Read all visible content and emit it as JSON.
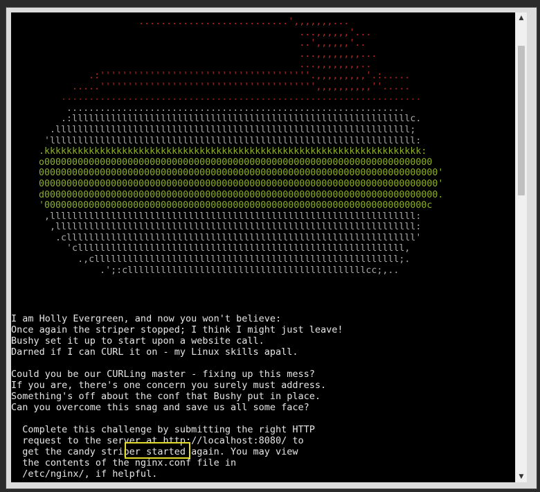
{
  "art_lines": [
    {
      "text": "                       ...........................',,,,,,,...",
      "tone": "c-red"
    },
    {
      "text": "                                                    ...,,,,,,'...",
      "tone": "c-red"
    },
    {
      "text": "                                                    ..',,,,,,'..",
      "tone": "c-red"
    },
    {
      "text": "                                                    ...,,,,,,,,...",
      "tone": "c-red"
    },
    {
      "text": "                                                    ...,,,,,,,,..",
      "tone": "c-red"
    },
    {
      "text": "              .:''''''''''''''''''''''''''''''''''''''.,,,,,,,,,'.:.....",
      "tone": "c-red"
    },
    {
      "text": "           .....''''''''''''''''''''''''''''''''''''''',,,,,,,,,,''.....",
      "tone": "c-red"
    },
    {
      "text": "         .................................................................",
      "tone": "c-darkred"
    },
    {
      "text": "          .............................................................",
      "tone": "c-grey"
    },
    {
      "text": "         .:lllllllllllllllllllllllllllllllllllllllllllllllllllllllllllllc.",
      "tone": "c-grey"
    },
    {
      "text": "       .llllllllllllllllllllllllllllllllllllllllllllllllllllllllllllllll;",
      "tone": "c-grey"
    },
    {
      "text": "      'llllllllllllllllllllllllllllllllllllllllllllllllllllllllllllllllll:",
      "tone": "c-grey"
    },
    {
      "text": "     .kkkkkkkkkkkkkkkkkkkkkkkkkkkkkkkkkkkkkkkkkkkkkkkkkkkkkkkkkkkkkkkkkkkk:",
      "tone": "c-green"
    },
    {
      "text": "     o0000000000000000000000000000000000000000000000000000000000000000000000",
      "tone": "c-green"
    },
    {
      "text": "     000000000000000000000000000000000000000000000000000000000000000000000000'",
      "tone": "c-green"
    },
    {
      "text": "     000000000000000000000000000000000000000000000000000000000000000000000000'",
      "tone": "c-green"
    },
    {
      "text": "     d00000000000000000000000000000000000000000000000000000000000000000000000.",
      "tone": "c-green"
    },
    {
      "text": "     '000000000000000000000000000000000000000000000000000000000000000000000c",
      "tone": "c-green"
    },
    {
      "text": "      ,llllllllllllllllllllllllllllllllllllllllllllllllllllllllllllllllll:",
      "tone": "c-grey"
    },
    {
      "text": "       ,lllllllllllllllllllllllllllllllllllllllllllllllllllllllllllllllll:",
      "tone": "c-grey"
    },
    {
      "text": "        .clllllllllllllllllllllllllllllllllllllllllllllllllllllllllllllll'",
      "tone": "c-grey"
    },
    {
      "text": "          'clllllllllllllllllllllllllllllllllllllllllllllllllllllllllll,",
      "tone": "c-grey"
    },
    {
      "text": "            .,clllllllllllllllllllllllllllllllllllllllllllllllllllllll;.",
      "tone": "c-grey"
    },
    {
      "text": "                .';:clllllllllllllllllllllllllllllllllllllllllllcc;,..",
      "tone": "c-grey"
    }
  ],
  "text_lines": [
    "I am Holly Evergreen, and now you won't believe:",
    "Once again the striper stopped; I think I might just leave!",
    "Bushy set it up to start upon a website call.",
    "Darned if I can CURL it on - my Linux skills apall.",
    "",
    "Could you be our CURLing master - fixing up this mess?",
    "If you are, there's one concern you surely must address.",
    "Something's off about the conf that Bushy put in place.",
    "Can you overcome this snag and save us all some face?",
    "",
    "  Complete this challenge by submitting the right HTTP",
    "  request to the server at http://localhost:8080/ to",
    "  get the candy striper started again. You may view",
    "  the contents of the nginx.conf file in",
    "  /etc/nginx/, if helpful."
  ],
  "scroll_up_glyph": "▲",
  "scroll_down_glyph": "▼"
}
